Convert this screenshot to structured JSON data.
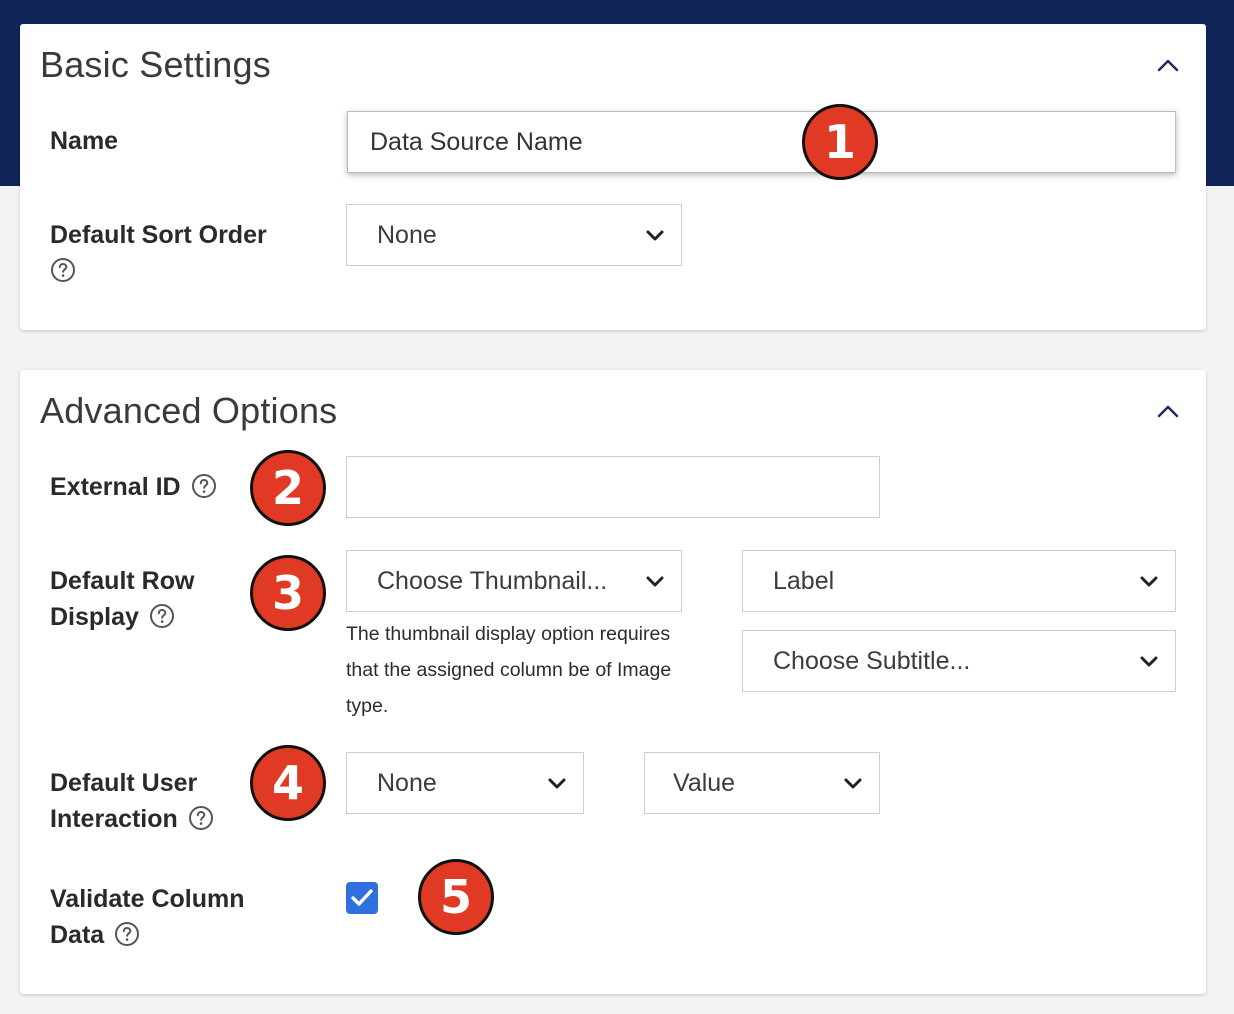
{
  "basic_settings": {
    "title": "Basic Settings",
    "name_label": "Name",
    "name_value": "Data Source Name",
    "sort_label": "Default Sort Order",
    "sort_value": "None"
  },
  "advanced_options": {
    "title": "Advanced Options",
    "external_id_label": "External ID",
    "external_id_value": "",
    "row_display_label_line1": "Default Row",
    "row_display_label_line2": "Display",
    "thumbnail_value": "Choose Thumbnail...",
    "label_value": "Label",
    "subtitle_value": "Choose Subtitle...",
    "thumbnail_help": "The thumbnail display option requires that the assigned column be of Image type.",
    "user_interaction_label_line1": "Default User",
    "user_interaction_label_line2": "Interaction",
    "interaction_value": "None",
    "interaction_field_value": "Value",
    "validate_label_line1": "Validate Column",
    "validate_label_line2": "Data",
    "validate_checked": true
  },
  "markers": [
    "1",
    "2",
    "3",
    "4",
    "5"
  ],
  "colors": {
    "header_bg": "#0f2557",
    "marker_red": "#e03a24",
    "checkbox_blue": "#2f6fe0"
  },
  "icons": {
    "collapse": "chevron-up-icon",
    "dropdown": "chevron-down-icon",
    "help": "question-circle-icon",
    "check": "check-icon"
  }
}
